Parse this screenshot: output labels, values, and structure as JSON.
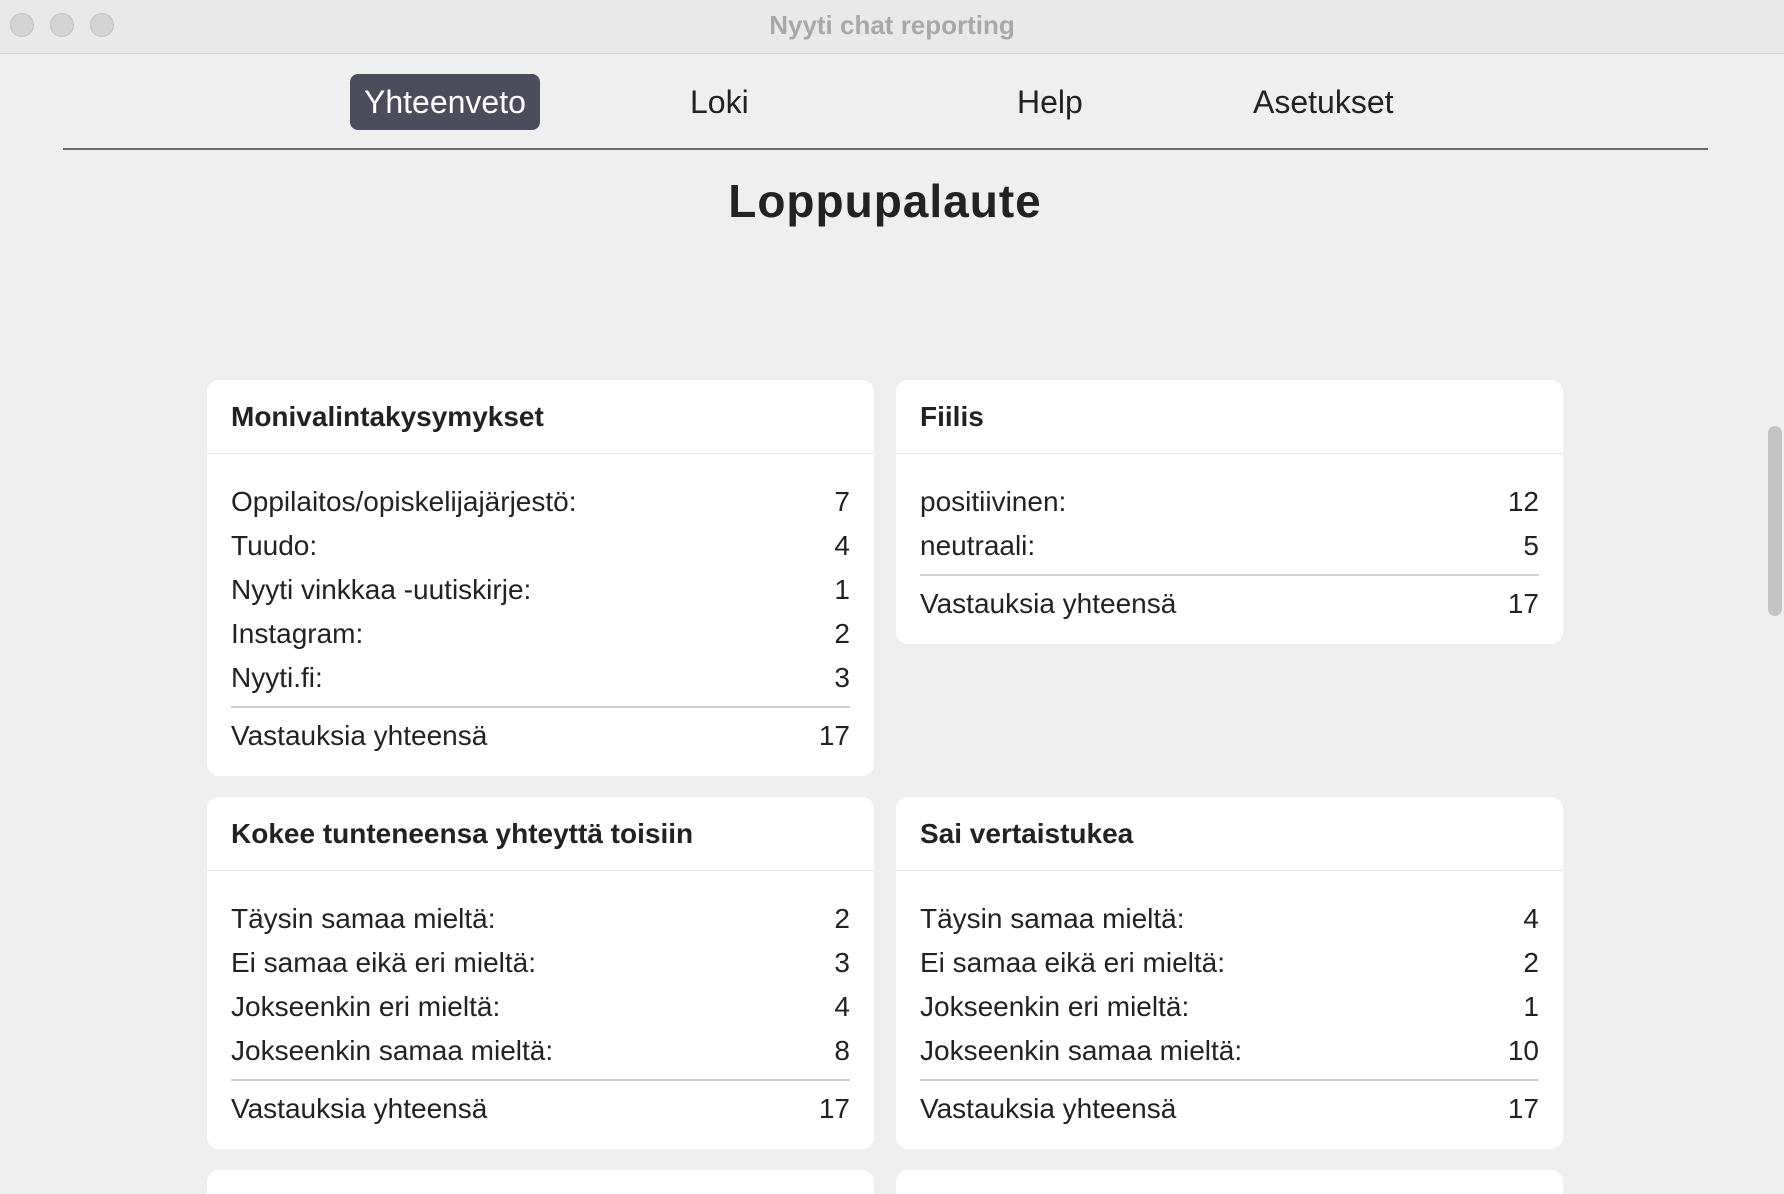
{
  "window": {
    "title": "Nyyti chat reporting"
  },
  "tabs": [
    {
      "label": "Yhteenveto",
      "active": true
    },
    {
      "label": "Loki",
      "active": false
    },
    {
      "label": "Help",
      "active": false
    },
    {
      "label": "Asetukset",
      "active": false
    }
  ],
  "page": {
    "title": "Loppupalaute"
  },
  "cards": [
    {
      "title": "Monivalintakysymykset",
      "rows": [
        {
          "label": "Oppilaitos/opiskelijajärjestö:",
          "value": "7"
        },
        {
          "label": "Tuudo:",
          "value": "4"
        },
        {
          "label": "Nyyti vinkkaa -uutiskirje:",
          "value": "1"
        },
        {
          "label": "Instagram:",
          "value": "2"
        },
        {
          "label": "Nyyti.fi:",
          "value": "3"
        }
      ],
      "total": {
        "label": "Vastauksia yhteensä",
        "value": "17"
      }
    },
    {
      "title": "Fiilis",
      "rows": [
        {
          "label": "positiivinen:",
          "value": "12"
        },
        {
          "label": "neutraali:",
          "value": "5"
        }
      ],
      "total": {
        "label": "Vastauksia yhteensä",
        "value": "17"
      }
    },
    {
      "title": "Kokee tunteneensa yhteyttä toisiin",
      "rows": [
        {
          "label": "Täysin samaa mieltä:",
          "value": "2"
        },
        {
          "label": "Ei samaa eikä eri mieltä:",
          "value": "3"
        },
        {
          "label": "Jokseenkin eri mieltä:",
          "value": "4"
        },
        {
          "label": "Jokseenkin samaa mieltä:",
          "value": "8"
        }
      ],
      "total": {
        "label": "Vastauksia yhteensä",
        "value": "17"
      }
    },
    {
      "title": "Sai vertaistukea",
      "rows": [
        {
          "label": "Täysin samaa mieltä:",
          "value": "4"
        },
        {
          "label": "Ei samaa eikä eri mieltä:",
          "value": "2"
        },
        {
          "label": "Jokseenkin eri mieltä:",
          "value": "1"
        },
        {
          "label": "Jokseenkin samaa mieltä:",
          "value": "10"
        }
      ],
      "total": {
        "label": "Vastauksia yhteensä",
        "value": "17"
      }
    }
  ]
}
